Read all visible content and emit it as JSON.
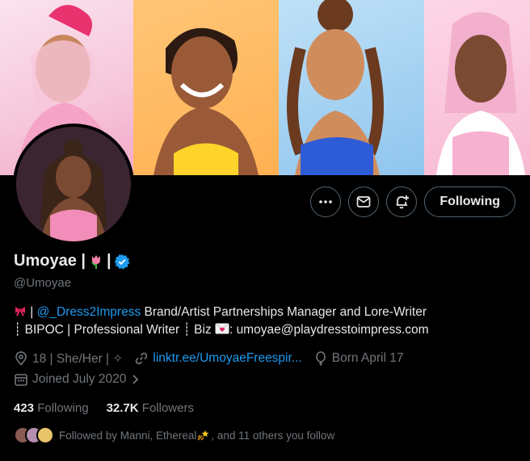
{
  "profile": {
    "display_name": "Umoyae |",
    "name_suffix": "|",
    "handle": "@Umoyae",
    "bio_line1_prefix": " | ",
    "bio_mention": "@_Dress2Impress",
    "bio_line1_suffix": " Brand/Artist Partnerships Manager and Lore-Writer",
    "bio_line2": "┊ BIPOC | Professional Writer ┊ Biz ",
    "bio_line2_email": ": umoyae@playdresstoimpress.com",
    "location": "18 | She/Her | ✧",
    "website": "linktr.ee/UmoyaeFreespir...",
    "birthday": "Born April 17",
    "joined": "Joined July 2020"
  },
  "actions": {
    "following_label": "Following"
  },
  "stats": {
    "following_count": "423",
    "following_label": "Following",
    "followers_count": "32.7K",
    "followers_label": "Followers"
  },
  "followed_by": {
    "text_prefix": "Followed by Manni, Ethereal",
    "text_suffix": ", and 11 others you follow"
  },
  "colors": {
    "accent": "#1d9bf0",
    "verified": "#1d9bf0",
    "muted": "#71767b"
  }
}
